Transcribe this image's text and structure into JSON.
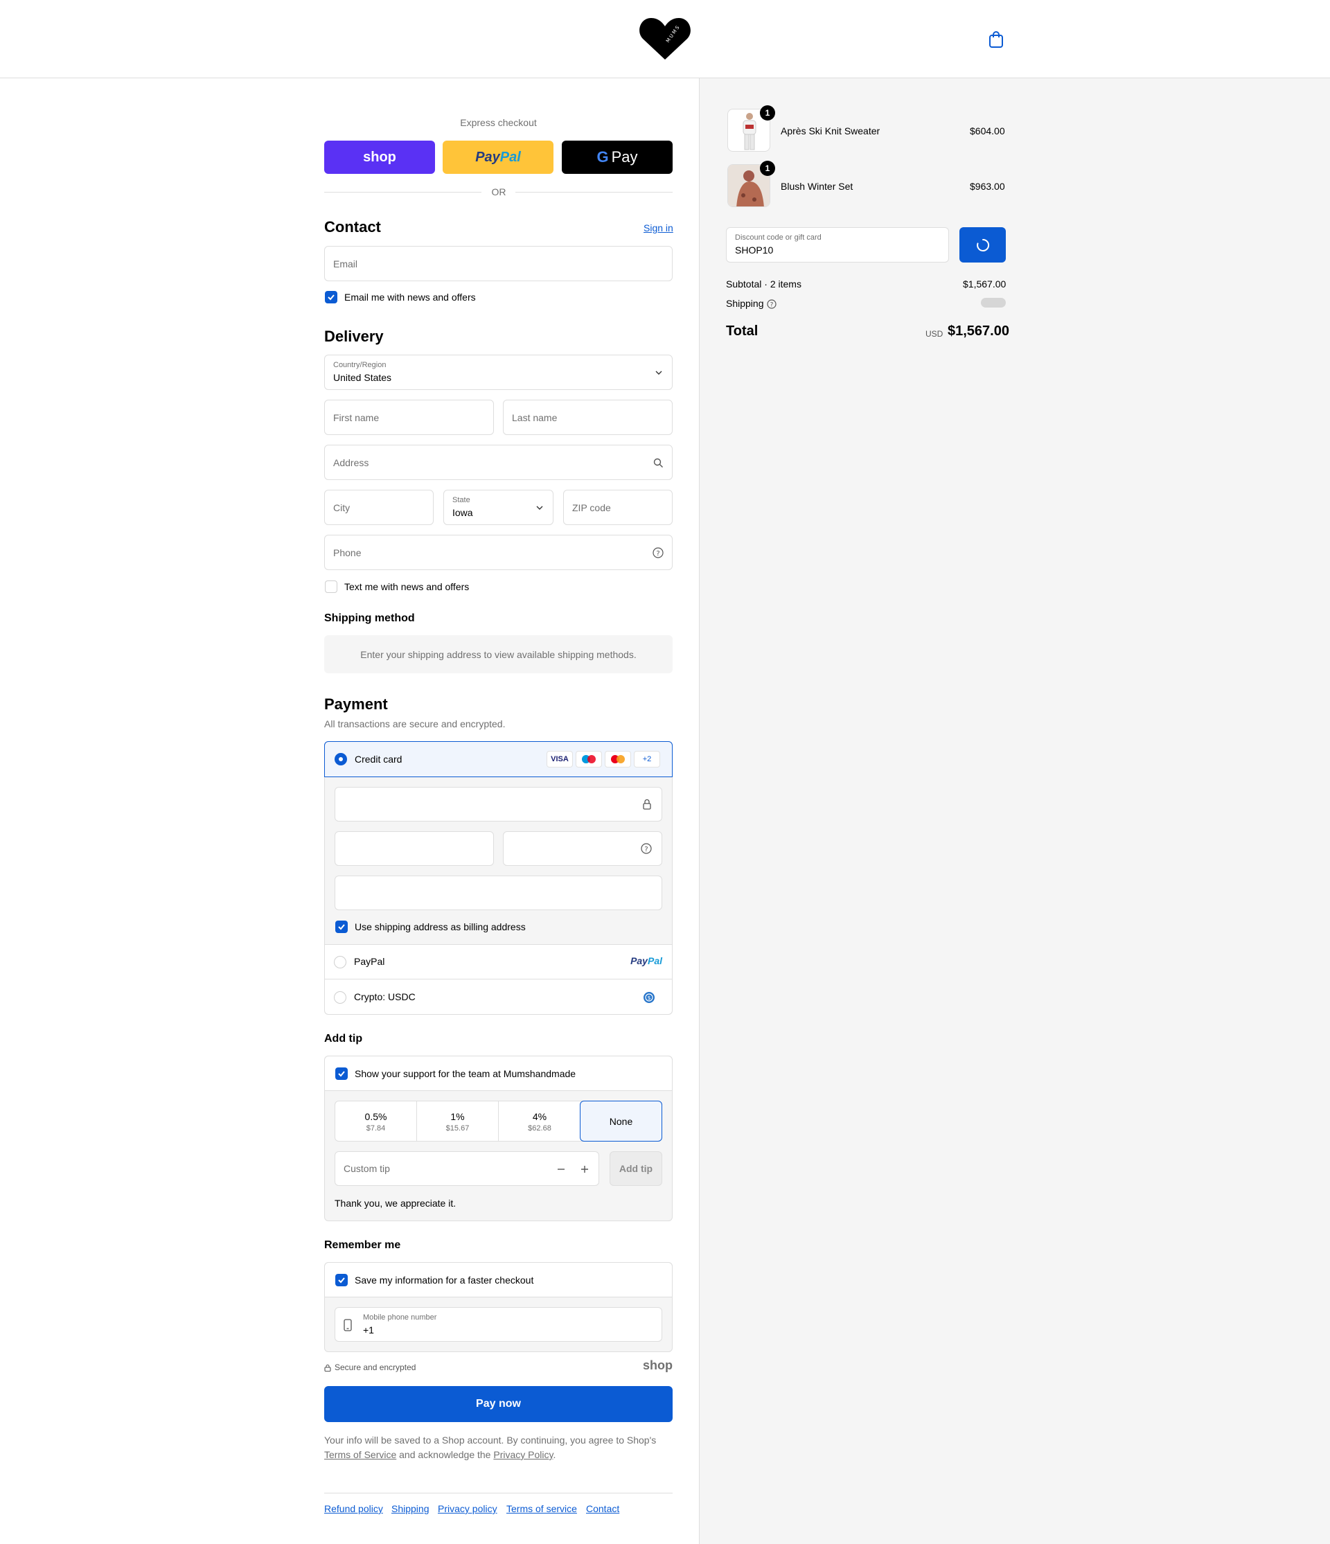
{
  "header": {
    "logo_text": "MUMS",
    "cart_icon": "shopping-bag-icon"
  },
  "express": {
    "title": "Express checkout",
    "shop_label": "shop",
    "paypal_label_pay": "Pay",
    "paypal_label_pal": "Pal",
    "gpay_label": "Pay",
    "or_label": "OR"
  },
  "contact": {
    "title": "Contact",
    "signin": "Sign in",
    "email_placeholder": "Email",
    "news_label": "Email me with news and offers"
  },
  "delivery": {
    "title": "Delivery",
    "country_label": "Country/Region",
    "country_value": "United States",
    "first_name": "First name",
    "last_name": "Last name",
    "address": "Address",
    "city": "City",
    "state_label": "State",
    "state_value": "Iowa",
    "zip": "ZIP code",
    "phone": "Phone",
    "text_label": "Text me with news and offers"
  },
  "shipping": {
    "title": "Shipping method",
    "message": "Enter your shipping address to view available shipping methods."
  },
  "payment": {
    "title": "Payment",
    "subtitle": "All transactions are secure and encrypted.",
    "credit_card": "Credit card",
    "visa": "VISA",
    "more_cards": "+2",
    "billing_label": "Use shipping address as billing address",
    "paypal": "PayPal",
    "paypal_logo_pay": "Pay",
    "paypal_logo_pal": "Pal",
    "crypto": "Crypto: USDC"
  },
  "tip": {
    "title": "Add tip",
    "support_label": "Show your support for the team at Mumshandmade",
    "options": [
      {
        "pct": "0.5%",
        "amt": "$7.84"
      },
      {
        "pct": "1%",
        "amt": "$15.67"
      },
      {
        "pct": "4%",
        "amt": "$62.68"
      }
    ],
    "none": "None",
    "custom_placeholder": "Custom tip",
    "add_button": "Add tip",
    "thanks": "Thank you, we appreciate it."
  },
  "remember": {
    "title": "Remember me",
    "save_label": "Save my information for a faster checkout",
    "mobile_label": "Mobile phone number",
    "mobile_value": "+1",
    "secure": "Secure and encrypted",
    "shop_mark": "shop"
  },
  "pay_button": "Pay now",
  "legal": {
    "text1": "Your info will be saved to a Shop account. By continuing, you agree to Shop's",
    "terms": "Terms of Service",
    "text2": "and acknowledge the",
    "privacy": "Privacy Policy",
    "period": "."
  },
  "footer": {
    "links": [
      "Refund policy",
      "Shipping",
      "Privacy policy",
      "Terms of service",
      "Contact"
    ]
  },
  "summary": {
    "items": [
      {
        "name": "Après Ski Knit Sweater",
        "price": "$604.00",
        "qty": "1"
      },
      {
        "name": "Blush Winter Set",
        "price": "$963.00",
        "qty": "1"
      }
    ],
    "discount_label": "Discount code or gift card",
    "discount_value": "SHOP10",
    "subtotal_label": "Subtotal · 2 items",
    "subtotal_value": "$1,567.00",
    "shipping_label": "Shipping",
    "total_label": "Total",
    "currency": "USD",
    "total_value": "$1,567.00"
  },
  "colors": {
    "accent": "#0b5bd3",
    "shop_purple": "#5a31f4",
    "paypal_yellow": "#ffc439"
  }
}
